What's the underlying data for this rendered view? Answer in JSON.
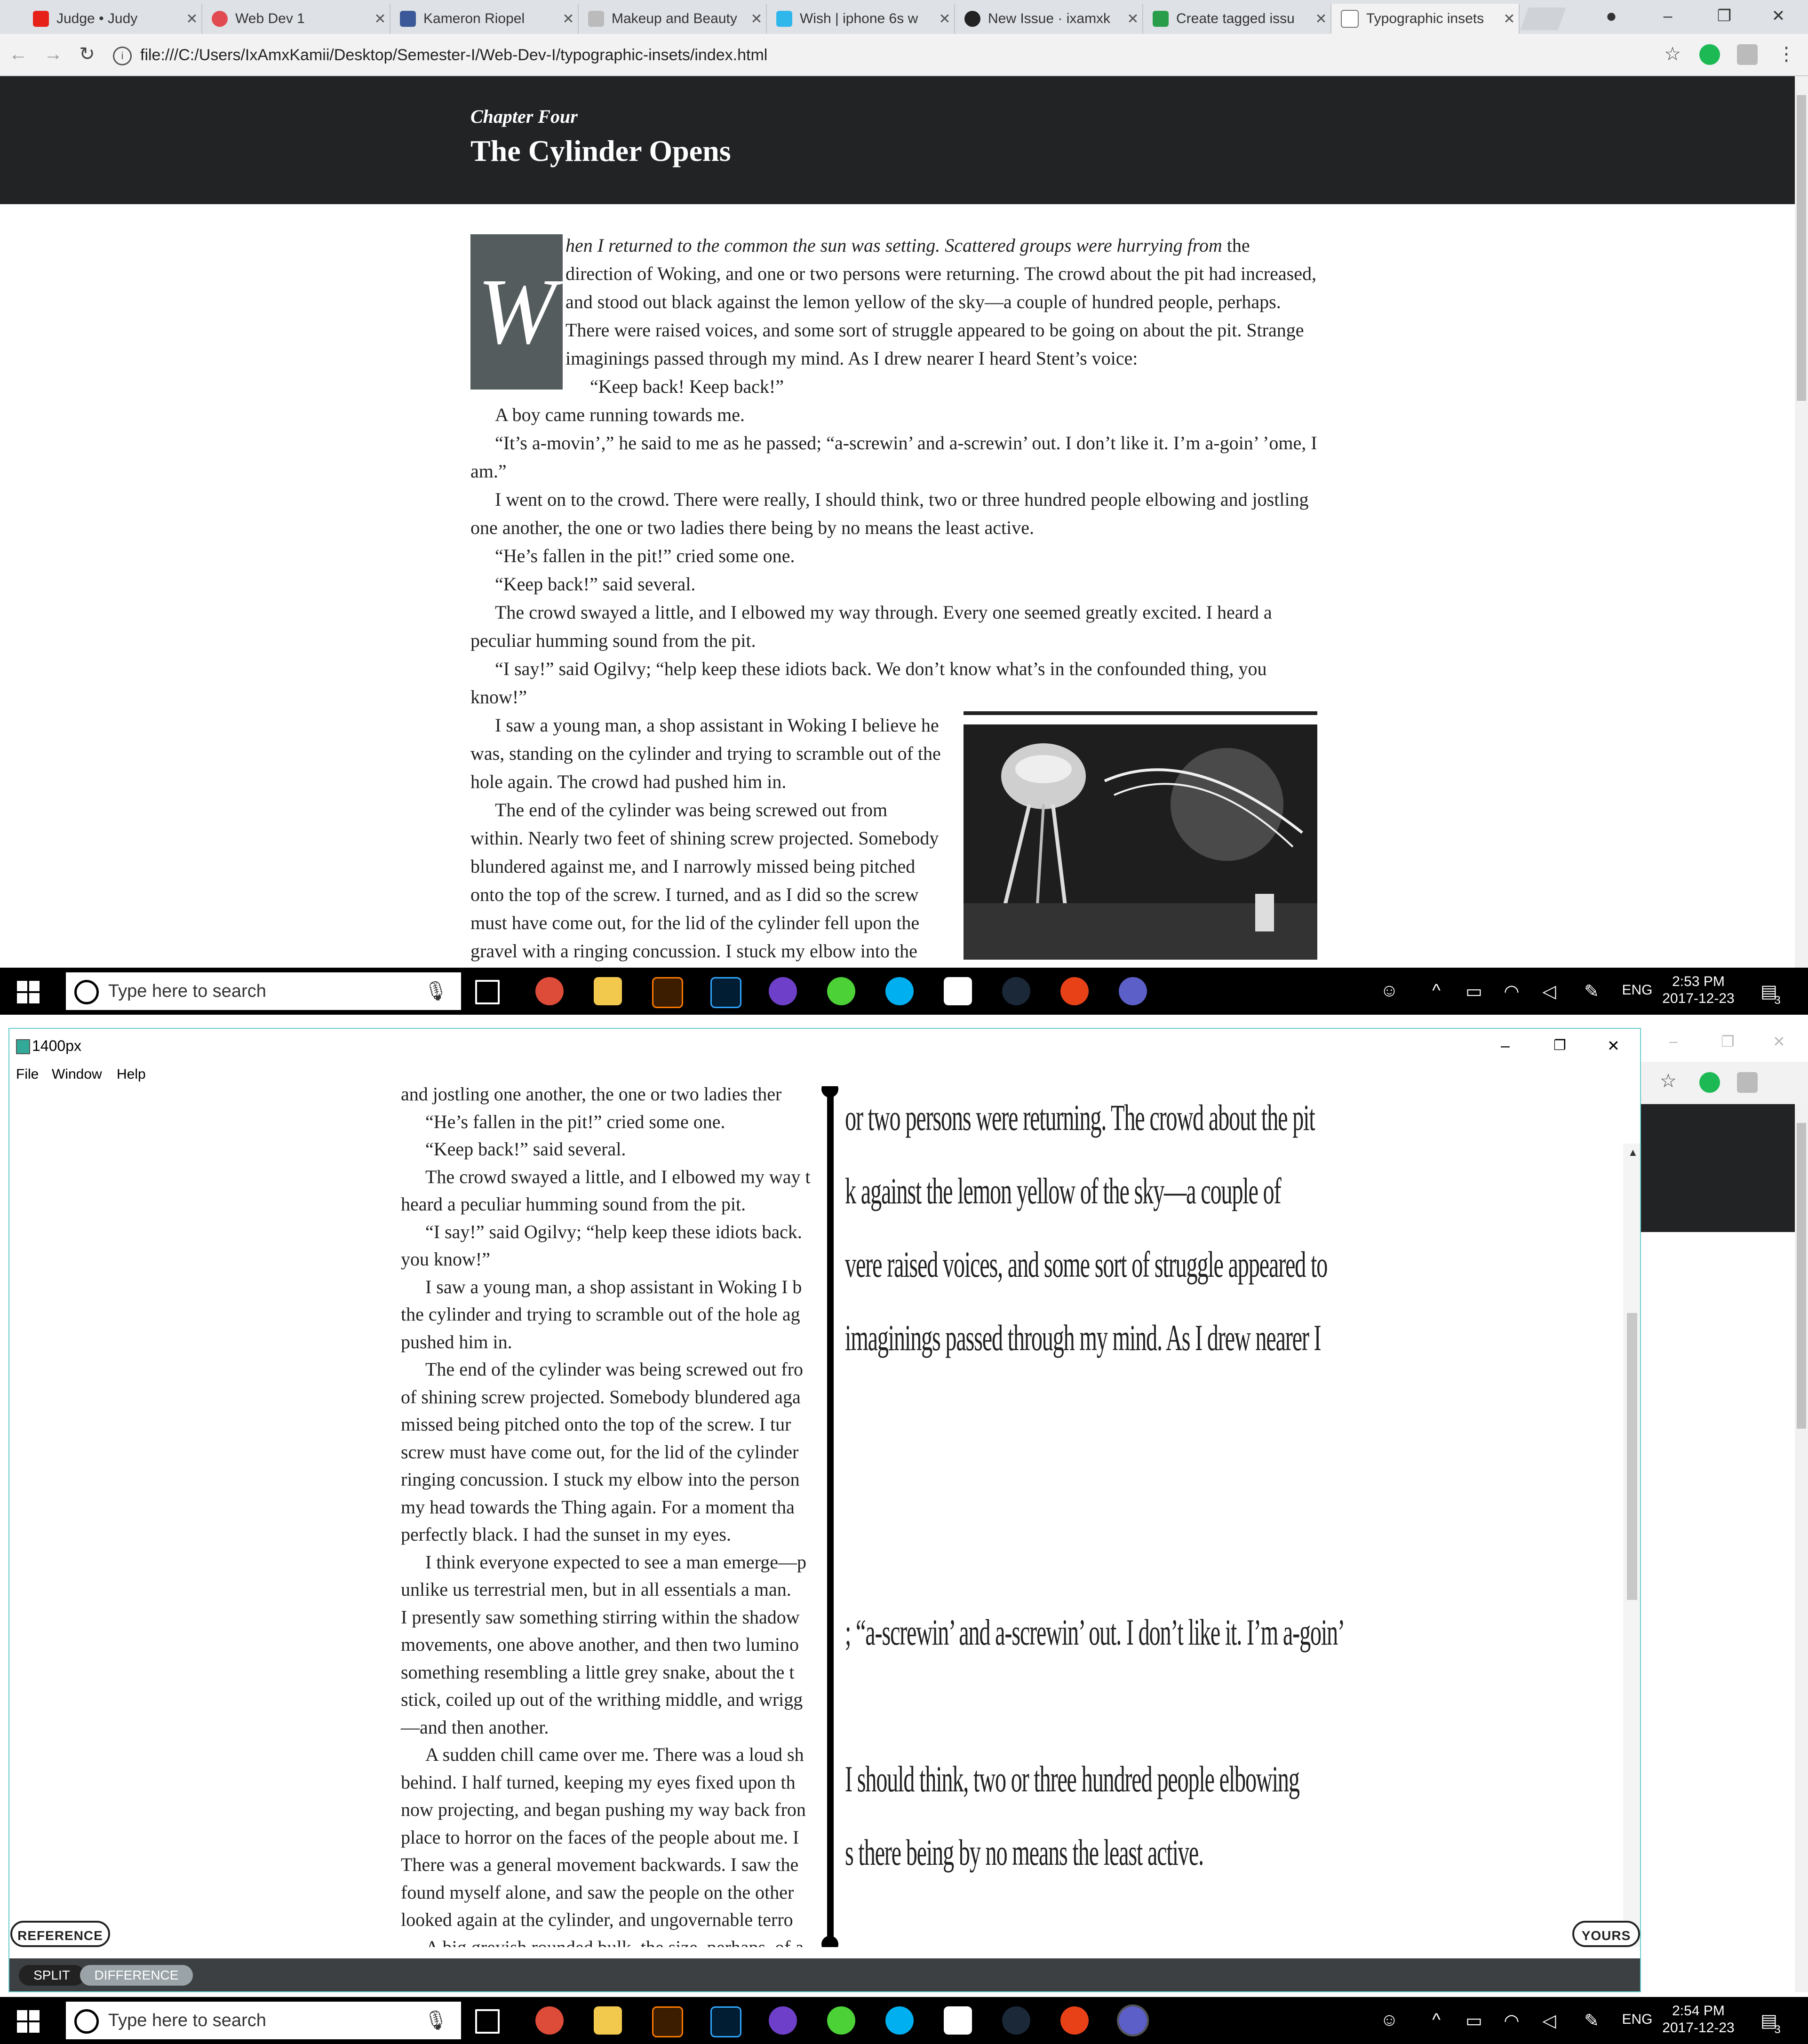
{
  "browser": {
    "tabs": [
      {
        "title": "Judge • Judy",
        "color": "#e62117"
      },
      {
        "title": "Web Dev 1",
        "color": "#e24a52"
      },
      {
        "title": "Kameron Riopel",
        "color": "#3b5998"
      },
      {
        "title": "Makeup and Beauty",
        "color": "#888888"
      },
      {
        "title": "Wish | iphone 6s w",
        "color": "#2fb7ec"
      },
      {
        "title": "New Issue · ixamxk",
        "color": "#222222"
      },
      {
        "title": "Create tagged issu",
        "color": "#2a9d4b"
      },
      {
        "title": "Typographic insets",
        "color": "#ffffff"
      }
    ],
    "close_glyph": "✕",
    "url": "file:///C:/Users/IxAmxKamii/Desktop/Semester-I/Web-Dev-I/typographic-insets/index.html",
    "icons": {
      "back": "arrow-left-icon",
      "forward": "arrow-right-icon",
      "reload": "reload-icon",
      "star": "star-icon",
      "account": "account-icon"
    }
  },
  "page": {
    "chapter": "Chapter Four",
    "title": "The Cylinder Opens",
    "dropcap": "W",
    "first_lead": "hen I returned to the common the sun was setting. Scattered groups were hurrying from",
    "first_rest": "the direction of Woking, and one or two persons were returning. The crowd about the pit had increased, and stood out black against the lemon yellow of the sky—a couple of hundred people, perhaps. There were raised voices, and some sort of struggle appeared to be going on about the pit. Strange imaginings passed through my mind. As I drew nearer I heard Stent’s voice:",
    "paragraphs": [
      "“Keep back! Keep back!”",
      "A boy came running towards me.",
      "“It’s a-movin’,” he said to me as he passed; “a-screwin’ and a-screwin’ out. I don’t like it. I’m a-goin’ ’ome, I am.”",
      "I went on to the crowd. There were really, I should think, two or three hundred people elbowing and jostling one another, the one or two ladies there being by no means the least active.",
      "“He’s fallen in the pit!” cried some one.",
      "“Keep back!” said several.",
      "The crowd swayed a little, and I elbowed my way through. Every one seemed greatly excited. I heard a peculiar humming sound from the pit.",
      "“I say!” said Ogilvy; “help keep these idiots back. We don’t know what’s in the confounded thing, you know!”",
      "I saw a young man, a shop assistant in Woking I believe he was, standing on the cylinder and trying to scramble out of the hole again. The crowd had pushed him in.",
      "The end of the cylinder was being screwed out from within. Nearly two feet of shining screw projected. Somebody blundered against me, and I narrowly missed being pitched onto the top of the screw. I turned, and as I did so the screw must have come out, for the lid of the cylinder fell upon the gravel with a ringing concussion. I stuck my elbow into the person behind me, and turned"
    ]
  },
  "taskbar_top": {
    "search_placeholder": "Type here to search",
    "time": "2:53 PM",
    "date": "2017-12-23",
    "lang": "ENG",
    "notif_count": "3"
  },
  "taskbar_bottom": {
    "search_placeholder": "Type here to search",
    "time": "2:54 PM",
    "date": "2017-12-23",
    "lang": "ENG",
    "notif_count": "3"
  },
  "compare_window": {
    "title": "1400px",
    "menu": [
      "File",
      "Window",
      "Help"
    ],
    "reference_label": "REFERENCE",
    "yours_label": "YOURS",
    "mode_split": "SPLIT",
    "mode_difference": "DIFFERENCE",
    "active_mode": "DIFFERENCE",
    "left_lines": [
      {
        "t": "and jostling one another, the one or two ladies ther",
        "i": false
      },
      {
        "t": "“He’s fallen in the pit!” cried some one.",
        "i": true
      },
      {
        "t": "“Keep back!” said several.",
        "i": true
      },
      {
        "t": "The crowd swayed a little, and I elbowed my way t",
        "i": true
      },
      {
        "t": "heard a peculiar humming sound from the pit.",
        "i": false
      },
      {
        "t": "“I say!” said Ogilvy; “help keep these idiots back.",
        "i": true
      },
      {
        "t": "you know!”",
        "i": false
      },
      {
        "t": "I saw a young man, a shop assistant in Woking I b",
        "i": true
      },
      {
        "t": "the cylinder and trying to scramble out of the hole ag",
        "i": false
      },
      {
        "t": "pushed him in.",
        "i": false
      },
      {
        "t": "The end of the cylinder was being screwed out fro",
        "i": true
      },
      {
        "t": "of shining screw projected. Somebody blundered aga",
        "i": false
      },
      {
        "t": "missed being pitched onto the top of the screw. I tur",
        "i": false
      },
      {
        "t": "screw must have come out, for the lid of the cylinder",
        "i": false
      },
      {
        "t": "ringing concussion. I stuck my elbow into the person",
        "i": false
      },
      {
        "t": "my head towards the Thing again. For a moment tha",
        "i": false
      },
      {
        "t": "perfectly black. I had the sunset in my eyes.",
        "i": false
      },
      {
        "t": "I think everyone expected to see a man emerge—p",
        "i": true
      },
      {
        "t": "unlike us terrestrial men, but in all essentials a man.",
        "i": false
      },
      {
        "t": "I presently saw something stirring within the shadow",
        "i": false
      },
      {
        "t": "movements, one above another, and then two lumino",
        "i": false
      },
      {
        "t": "something resembling a little grey snake, about the t",
        "i": false
      },
      {
        "t": "stick, coiled up out of the writhing middle, and wrigg",
        "i": false
      },
      {
        "t": "—and then another.",
        "i": false
      },
      {
        "t": "A sudden chill came over me. There was a loud sh",
        "i": true
      },
      {
        "t": "behind. I half turned, keeping my eyes fixed upon th",
        "i": false
      },
      {
        "t": "now projecting, and began pushing my way back fron",
        "i": false
      },
      {
        "t": "place to horror on the faces of the people about me. I",
        "i": false
      },
      {
        "t": "There was a general movement backwards. I saw the",
        "i": false
      },
      {
        "t": "found myself alone, and saw the people on the other",
        "i": false
      },
      {
        "t": "looked again at the cylinder, and ungovernable terro",
        "i": false
      },
      {
        "t": "A big greyish rounded bulk, the size, perhaps, of a",
        "i": true
      }
    ],
    "diff_lines": [
      "or two persons were returning. The crowd about the pit",
      "k against the lemon yellow of the sky—a couple of",
      "vere raised voices, and some sort of struggle appeared to",
      "imaginings passed through my mind. As I drew nearer I",
      "; “a-screwin’ and a-screwin’ out. I don’t like it. I’m a-goin’",
      "I should think, two or three hundred people elbowing",
      "s there being by no means the least active."
    ]
  }
}
